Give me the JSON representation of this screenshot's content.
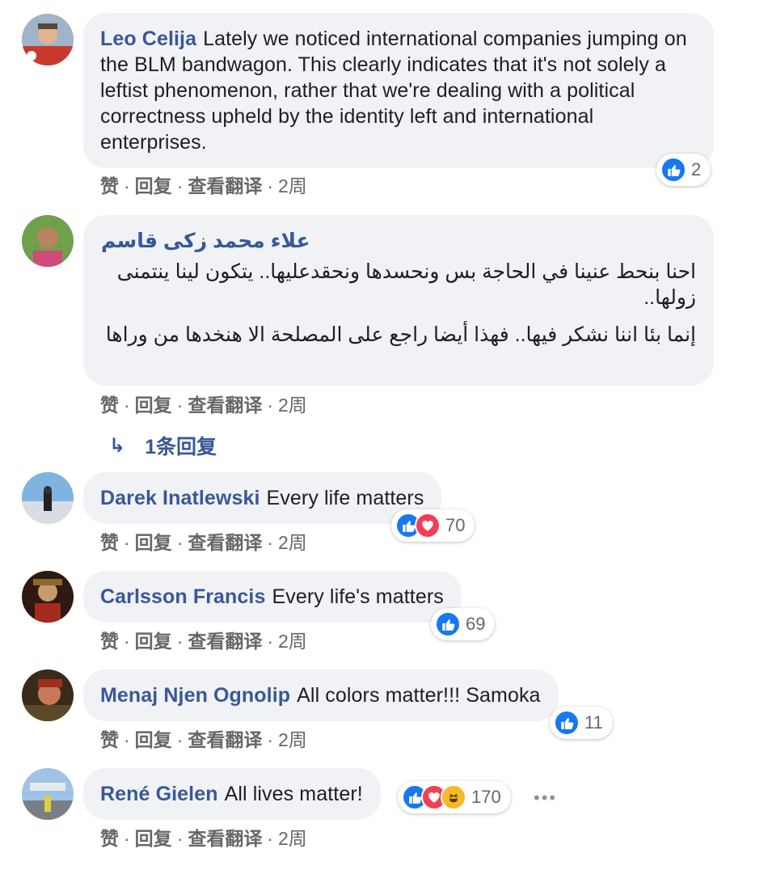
{
  "comments": [
    {
      "author": "Leo Celija",
      "text": "Lately we noticed international companies jumping on the BLM bandwagon. This clearly indicates that it's not solely a leftist phenomenon, rather that we're dealing with a political correctness upheld by the identity left and international enterprises.",
      "avatar": "avatar-leo",
      "actions": {
        "like": "赞",
        "reply": "回复",
        "translate": "查看翻译",
        "time": "2周"
      },
      "reactions": {
        "icons": [
          "like"
        ],
        "count": "2"
      }
    },
    {
      "author": "علاء محمد زكى قاسم",
      "paragraph1": "احنا بنحط عنينا في الحاجة بس ونحسدها ونحقدعليها.. يتكون لينا ينتمنى زولها..",
      "paragraph2": "إنما بئا اننا نشكر فيها.. فهذا أيضا راجع على المصلحة الا هنخدها من وراها",
      "actions": {
        "like": "赞",
        "reply": "回复",
        "translate": "查看翻译",
        "time": "2周"
      },
      "replies_label": "1条回复"
    },
    {
      "author": "Darek Inatlewski",
      "text": "Every life matters",
      "actions": {
        "like": "赞",
        "reply": "回复",
        "translate": "查看翻译",
        "time": "2周"
      },
      "reactions": {
        "icons": [
          "like",
          "love"
        ],
        "count": "70"
      }
    },
    {
      "author": "Carlsson Francis",
      "text": "Every life's matters",
      "actions": {
        "like": "赞",
        "reply": "回复",
        "translate": "查看翻译",
        "time": "2周"
      },
      "reactions": {
        "icons": [
          "like"
        ],
        "count": "69"
      }
    },
    {
      "author": "Menaj Njen Ognolip",
      "text": "All colors matter!!! Samoka",
      "actions": {
        "like": "赞",
        "reply": "回复",
        "translate": "查看翻译",
        "time": "2周"
      },
      "reactions": {
        "icons": [
          "like"
        ],
        "count": "11"
      }
    },
    {
      "author": "René Gielen",
      "text": "All lives matter!",
      "actions": {
        "like": "赞",
        "reply": "回复",
        "translate": "查看翻译",
        "time": "2周"
      },
      "reactions": {
        "icons": [
          "like",
          "love",
          "haha"
        ],
        "count": "170"
      }
    }
  ],
  "colors": {
    "author": "#385898",
    "bubble": "#f0f2f5",
    "like": "#1877f2",
    "love": "#f33e58",
    "haha": "#f7b928"
  }
}
